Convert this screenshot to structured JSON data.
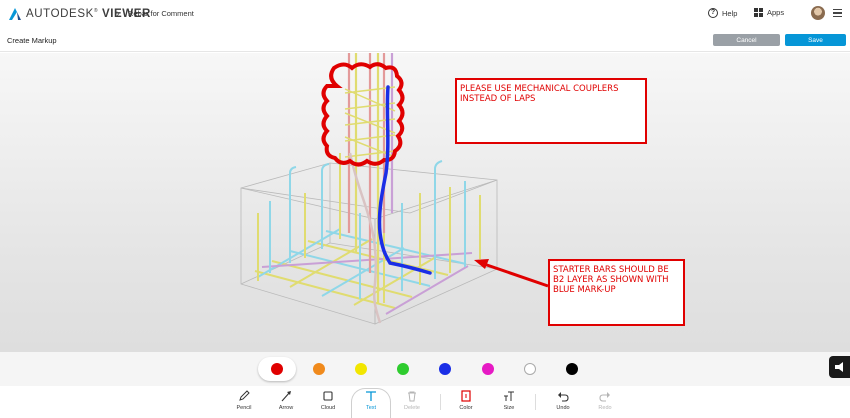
{
  "header": {
    "brand_light": "AUTODESK",
    "brand_bold": "VIEWER",
    "breadcrumb_sep": "›",
    "breadcrumb": "Rebar for Comment",
    "help_label": "Help",
    "apps_label": "Apps"
  },
  "subheader": {
    "title": "Create Markup",
    "cancel_label": "Cancel",
    "save_label": "Save"
  },
  "markups": {
    "note1": "PLEASE USE MECHANICAL COUPLERS INSTEAD OF LAPS",
    "note2": "STARTER BARS SHOULD BE B2 LAYER AS SHOWN WITH BLUE MARK-UP"
  },
  "palette": {
    "selected": "#e00000",
    "colors": [
      "#e00000",
      "#f08a1c",
      "#f2e600",
      "#2ecc2e",
      "#1a2ee6",
      "#e61ac4",
      "#ffffff",
      "#000000"
    ]
  },
  "toolbar": {
    "tools": [
      {
        "label": "Pencil",
        "icon": "pencil-icon"
      },
      {
        "label": "Arrow",
        "icon": "arrow-icon"
      },
      {
        "label": "Cloud",
        "icon": "cloud-icon"
      },
      {
        "label": "Text",
        "icon": "text-icon"
      },
      {
        "label": "Delete",
        "icon": "trash-icon"
      },
      {
        "label": "Color",
        "icon": "color-icon"
      },
      {
        "label": "Size",
        "icon": "size-icon"
      },
      {
        "label": "Undo",
        "icon": "undo-icon"
      },
      {
        "label": "Redo",
        "icon": "redo-icon"
      }
    ],
    "selected_tool": "Text",
    "accent": "#0696d7"
  }
}
